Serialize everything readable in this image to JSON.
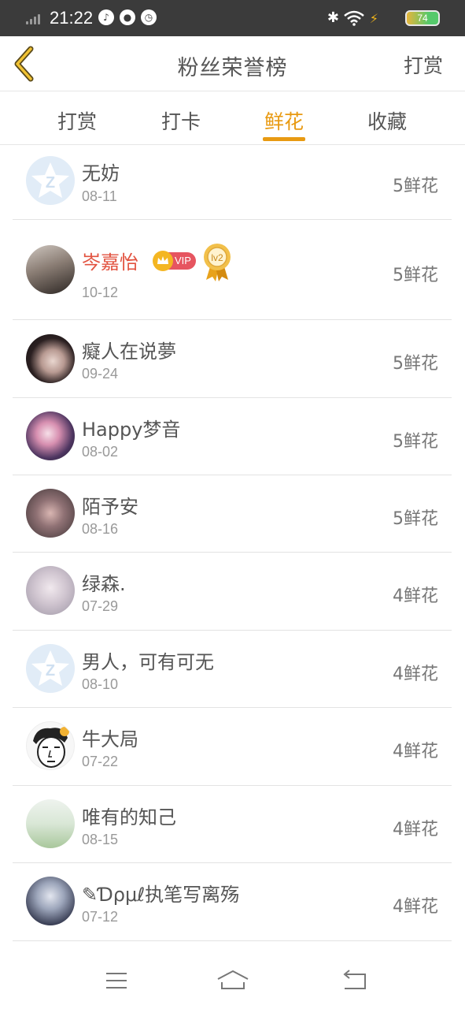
{
  "status_bar": {
    "time": "21:22",
    "app_icons": [
      "music-icon",
      "wechat-icon",
      "alarm-icon"
    ],
    "battery_level": "74"
  },
  "header": {
    "title": "粉丝荣誉榜",
    "action_label": "打赏",
    "back_icon": "chevron-left-icon"
  },
  "tabs": [
    {
      "label": "打赏",
      "active": false
    },
    {
      "label": "打卡",
      "active": false
    },
    {
      "label": "鲜花",
      "active": true
    },
    {
      "label": "收藏",
      "active": false
    }
  ],
  "list": [
    {
      "name": "无妨",
      "date": "08-11",
      "flowers": "5鲜花",
      "avatar": "default-avatar"
    },
    {
      "name": "岑嘉怡",
      "date": "10-12",
      "flowers": "5鲜花",
      "avatar": "photo-avatar",
      "vip": true,
      "vip_label": "VIP",
      "level_label": "lv2"
    },
    {
      "name": "癡人在说夢",
      "date": "09-24",
      "flowers": "5鲜花",
      "avatar": "photo-avatar"
    },
    {
      "name": "Happy梦音",
      "date": "08-02",
      "flowers": "5鲜花",
      "avatar": "photo-avatar"
    },
    {
      "name": "陌予安",
      "date": "08-16",
      "flowers": "5鲜花",
      "avatar": "photo-avatar"
    },
    {
      "name": "绿森.",
      "date": "07-29",
      "flowers": "4鲜花",
      "avatar": "photo-avatar"
    },
    {
      "name": "男人，可有可无",
      "date": "08-10",
      "flowers": "4鲜花",
      "avatar": "default-avatar"
    },
    {
      "name": "牛大局",
      "date": "07-22",
      "flowers": "4鲜花",
      "avatar": "photo-avatar"
    },
    {
      "name": "唯有的知己",
      "date": "08-15",
      "flowers": "4鲜花",
      "avatar": "photo-avatar"
    },
    {
      "name": "✎Ɗρμℓ执笔写离殇",
      "date": "07-12",
      "flowers": "4鲜花",
      "avatar": "photo-avatar"
    }
  ],
  "bottom_nav": {
    "items": [
      "menu-icon",
      "home-icon",
      "back-icon"
    ]
  },
  "colors": {
    "accent": "#e89a12",
    "vip_name": "#e2523f",
    "status_bar_bg": "#3b3b3b"
  }
}
